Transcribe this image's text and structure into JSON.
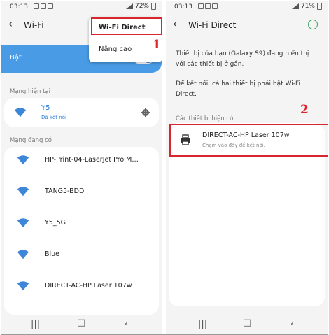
{
  "left_screen": {
    "status": {
      "time": "03:13",
      "battery": "72%"
    },
    "title": "Wi-Fi",
    "toggle_label": "Bật",
    "current_network_header": "Mạng hiện tại",
    "current_network": {
      "name": "Y5",
      "status": "Đã kết nối"
    },
    "available_header": "Mạng đang có",
    "networks": [
      "HP-Print-04-LaserJet Pro M…",
      "TANG5-BDD",
      "Y5_5G",
      "Blue",
      "DIRECT-AC-HP Laser 107w"
    ],
    "menu": {
      "item1": "Wi-Fi Direct",
      "item2": "Nâng cao"
    },
    "callout": "1"
  },
  "right_screen": {
    "status": {
      "time": "03:13",
      "battery": "71%"
    },
    "title": "Wi-Fi Direct",
    "description1": "Thiết bị của bạn (Galaxy S9) đang hiển thị với các thiết bị ở gần.",
    "description2": "Để kết nối, cả hai thiết bị phải bật Wi-Fi Direct.",
    "available_header": "Các thiết bị hiện có",
    "device": {
      "name": "DIRECT-AC-HP Laser 107w",
      "hint": "Chạm vào đây để kết nối."
    },
    "callout": "2"
  },
  "icons": {
    "wifi": "wifi-icon",
    "settings": "gear-icon",
    "printer": "printer-icon",
    "back": "back-arrow-icon"
  },
  "colors": {
    "accent": "#4a9be5",
    "highlight": "#d8262f"
  }
}
